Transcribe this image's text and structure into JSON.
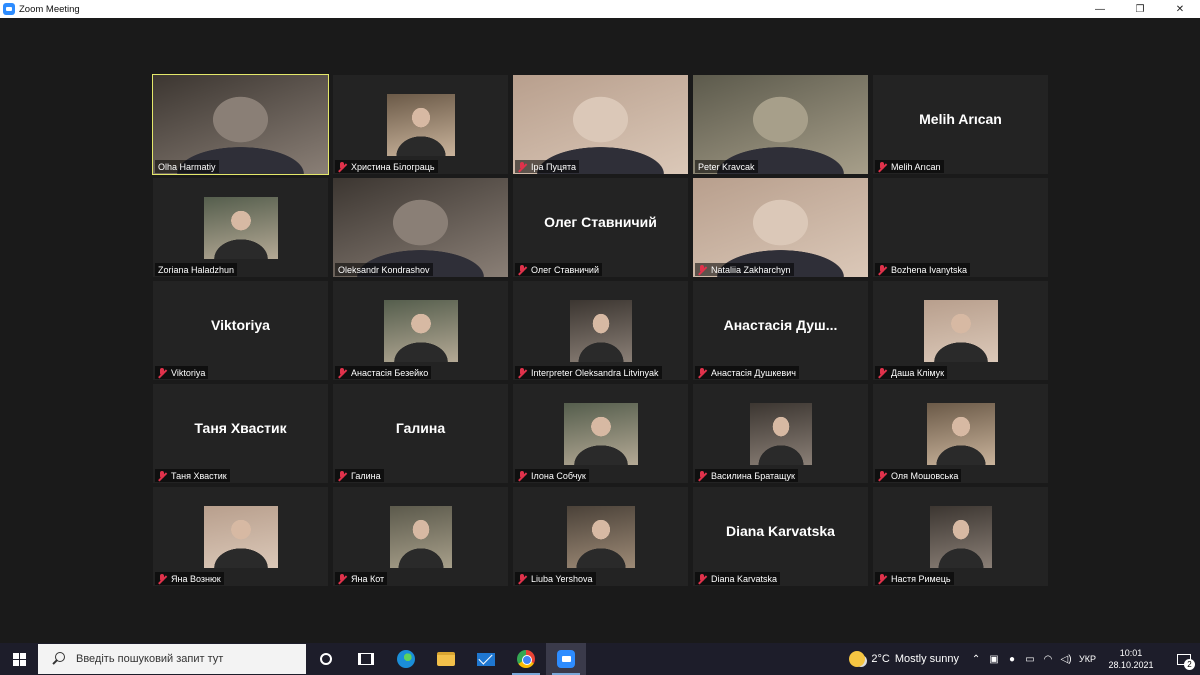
{
  "window": {
    "title": "Zoom Meeting",
    "controls": [
      "minimize-icon",
      "maximize-icon",
      "close-icon"
    ]
  },
  "participants": [
    {
      "name": "Olha Harmatiy",
      "muted": false,
      "active_speaker": true,
      "display": "video"
    },
    {
      "name": "Христина Білограць",
      "muted": true,
      "display": "photo"
    },
    {
      "name": "Іра Пуцята",
      "muted": true,
      "display": "video"
    },
    {
      "name": "Peter Kravcak",
      "muted": false,
      "display": "video"
    },
    {
      "name": "Melih Arıcan",
      "muted": true,
      "display": "name",
      "big_name": "Melih Arıcan"
    },
    {
      "name": "Zoriana Haladzhun",
      "muted": false,
      "display": "photo"
    },
    {
      "name": "Oleksandr Kondrashov",
      "muted": false,
      "display": "video"
    },
    {
      "name": "Олег Ставничий",
      "muted": true,
      "display": "name",
      "big_name": "Олег Ставничий"
    },
    {
      "name": "Nataliia Zakharchyn",
      "muted": true,
      "display": "video"
    },
    {
      "name": "Bozhena Ivanytska",
      "muted": true,
      "display": "blank"
    },
    {
      "name": "Viktoriya",
      "muted": true,
      "display": "name",
      "big_name": "Viktoriya"
    },
    {
      "name": "Анастасія Безейко",
      "muted": true,
      "display": "photo"
    },
    {
      "name": "Interpreter Oleksandra Litvinyak",
      "muted": true,
      "display": "photo"
    },
    {
      "name": "Анастасія Душкевич",
      "muted": true,
      "display": "name",
      "big_name": "Анастасія Душ..."
    },
    {
      "name": "Даша Клімук",
      "muted": true,
      "display": "photo"
    },
    {
      "name": "Таня Хвастик",
      "muted": true,
      "display": "name",
      "big_name": "Таня Хвастик"
    },
    {
      "name": "Галина",
      "muted": true,
      "display": "name",
      "big_name": "Галина"
    },
    {
      "name": "Ілона Собчук",
      "muted": true,
      "display": "photo"
    },
    {
      "name": "Василина Братащук",
      "muted": true,
      "display": "photo"
    },
    {
      "name": "Оля Мошовська",
      "muted": true,
      "display": "photo"
    },
    {
      "name": "Яна Вознюк",
      "muted": true,
      "display": "photo"
    },
    {
      "name": "Яна Кот",
      "muted": true,
      "display": "photo"
    },
    {
      "name": "Liuba Yershova",
      "muted": true,
      "display": "photo"
    },
    {
      "name": "Diana Karvatska",
      "muted": true,
      "display": "name",
      "big_name": "Diana Karvatska"
    },
    {
      "name": "Настя Римець",
      "muted": true,
      "display": "photo"
    }
  ],
  "taskbar": {
    "search_placeholder": "Введіть пошуковий запит тут",
    "apps": [
      "cortana-icon",
      "task-view-icon",
      "edge-icon",
      "file-explorer-icon",
      "mail-icon",
      "chrome-icon",
      "zoom-icon"
    ],
    "weather": {
      "temp": "2°C",
      "condition": "Mostly sunny"
    },
    "language": "УКР",
    "time": "10:01",
    "date": "28.10.2021",
    "notifications": "2"
  },
  "colors": {
    "background": "#1a1a1a",
    "tile": "#232323",
    "active_border": "#e4e86a",
    "muted_icon": "#e0324b",
    "taskbar": "#1d1d2a"
  }
}
